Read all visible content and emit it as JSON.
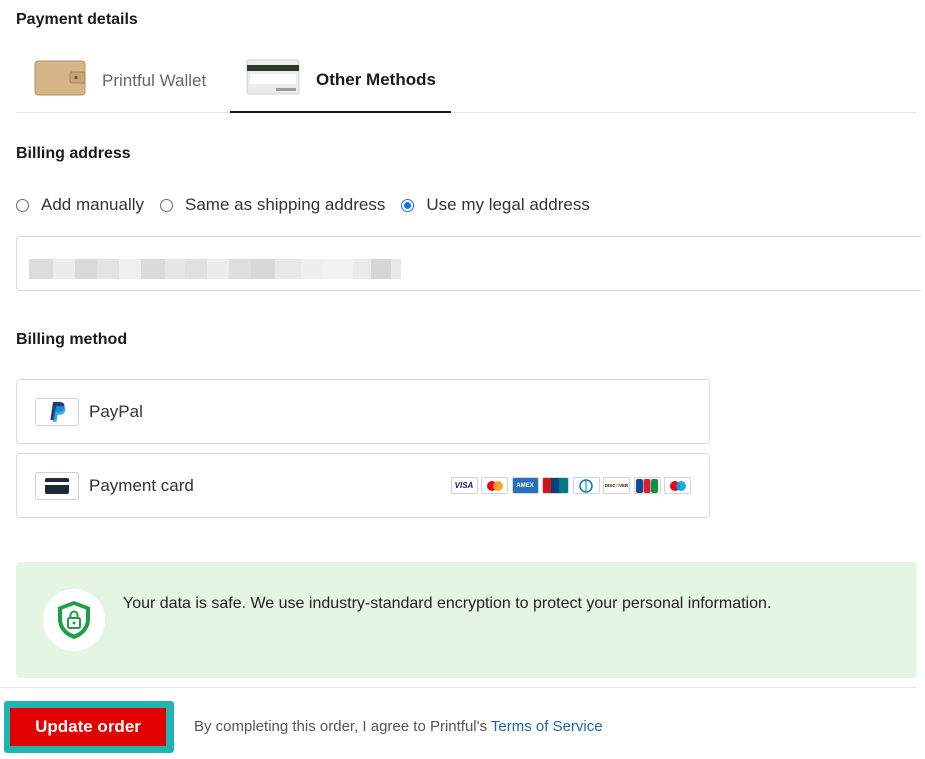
{
  "payment": {
    "title": "Payment details"
  },
  "tabs": [
    {
      "label": "Printful Wallet",
      "icon": "wallet-icon",
      "active": false
    },
    {
      "label": "Other Methods",
      "icon": "card-stack-icon",
      "active": true
    }
  ],
  "billing_address": {
    "title": "Billing address",
    "options": [
      {
        "label": "Add manually",
        "checked": false
      },
      {
        "label": "Same as shipping address",
        "checked": false
      },
      {
        "label": "Use my legal address",
        "checked": true
      }
    ]
  },
  "billing_method": {
    "title": "Billing method",
    "methods": [
      {
        "label": "PayPal",
        "icon": "paypal-icon"
      },
      {
        "label": "Payment card",
        "icon": "credit-card-icon"
      }
    ],
    "card_logos": [
      "visa",
      "mastercard",
      "amex",
      "unionpay",
      "diners",
      "discover",
      "jcb",
      "maestro"
    ]
  },
  "notice": {
    "text": "Your data is safe. We use industry-standard encryption to protect your personal information.",
    "icon": "shield-lock-icon"
  },
  "footer": {
    "button": "Update order",
    "agree_text": "By completing this order, I agree to Printful's ",
    "terms_link": "Terms of Service"
  },
  "colors": {
    "accent_red": "#e30000",
    "highlight": "#1fb5b3",
    "link": "#1f63b3",
    "notice_bg": "#e5f5e3",
    "radio_blue": "#1b6fe0"
  }
}
